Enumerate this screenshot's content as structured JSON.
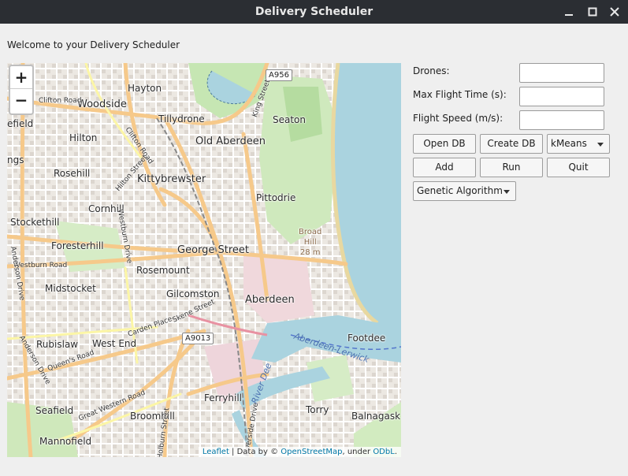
{
  "window": {
    "title": "Delivery Scheduler",
    "controls": [
      "minimize-icon",
      "maximize-icon",
      "close-icon"
    ]
  },
  "welcome_text": "Welcome to your Delivery Scheduler",
  "map": {
    "zoom_in_label": "+",
    "zoom_out_label": "−",
    "attribution": {
      "leaflet": "Leaflet",
      "sep1": " | Data by © ",
      "osm": "OpenStreetMap",
      "sep2": ", under ",
      "odbl": "ODbL",
      "end": "."
    },
    "places": {
      "hayton": "Hayton",
      "woodside": "Woodside",
      "clifton_road": "Clifton Road",
      "tillydrone": "Tillydrone",
      "seaton": "Seaton",
      "hilton": "Hilton",
      "old_aberdeen": "Old Aberdeen",
      "efield": "efield",
      "ngs": "ngs",
      "rosehill": "Rosehill",
      "kittybrewster": "Kittybrewster",
      "cornhill": "Cornhill",
      "pittodrie": "Pittodrie",
      "stockethill": "Stockethill",
      "broad_hill": "Broad",
      "broad_hill_2": "Hill",
      "broad_hill_3": "28 m",
      "foresterhill": "Foresterhill",
      "george_street": "George Street",
      "westburn_road": "Westburn Road",
      "rosemount": "Rosemount",
      "midstocket": "Midstocket",
      "gilcomston": "Gilcomston",
      "aberdeen": "Aberdeen",
      "rubislaw": "Rubislaw",
      "west_end": "West End",
      "footdee": "Footdee",
      "aberdeen_lerwick": "Aberdeen-Lerwick",
      "queens_road": "Queen's Road",
      "anderson_drive": "Anderson Drive",
      "seafield": "Seafield",
      "broomhill": "Broomhill",
      "ferryhill": "Ferryhill",
      "torry": "Torry",
      "balnagask": "Balnagask",
      "mannofield": "Mannofield",
      "great_western_road": "Great Western Road",
      "westburn_drive": "Westburn Drive",
      "hilton_street": "Hilton Street",
      "king_street": "King Street",
      "skene_street": "Skene Street",
      "carden_place": "Carden Place",
      "river_dee": "River Dee",
      "riverside_drive": "Riverside Drive",
      "holburn_street": "Holburn Street",
      "clifton_road_2": "Clifton Road",
      "anderson_drive_2": "Anderson Drive"
    },
    "shields": {
      "a956": "A956",
      "a9013": "A9013"
    }
  },
  "form": {
    "drones_label": "Drones:",
    "drones_value": "",
    "max_flight_label": "Max Flight Time (s):",
    "max_flight_value": "",
    "speed_label": "Flight Speed (m/s):",
    "speed_value": "",
    "open_db": "Open DB",
    "create_db": "Create DB",
    "clustering_selected": "kMeans",
    "add": "Add",
    "run": "Run",
    "quit": "Quit",
    "algorithm_selected": "Genetic Algorithm"
  }
}
